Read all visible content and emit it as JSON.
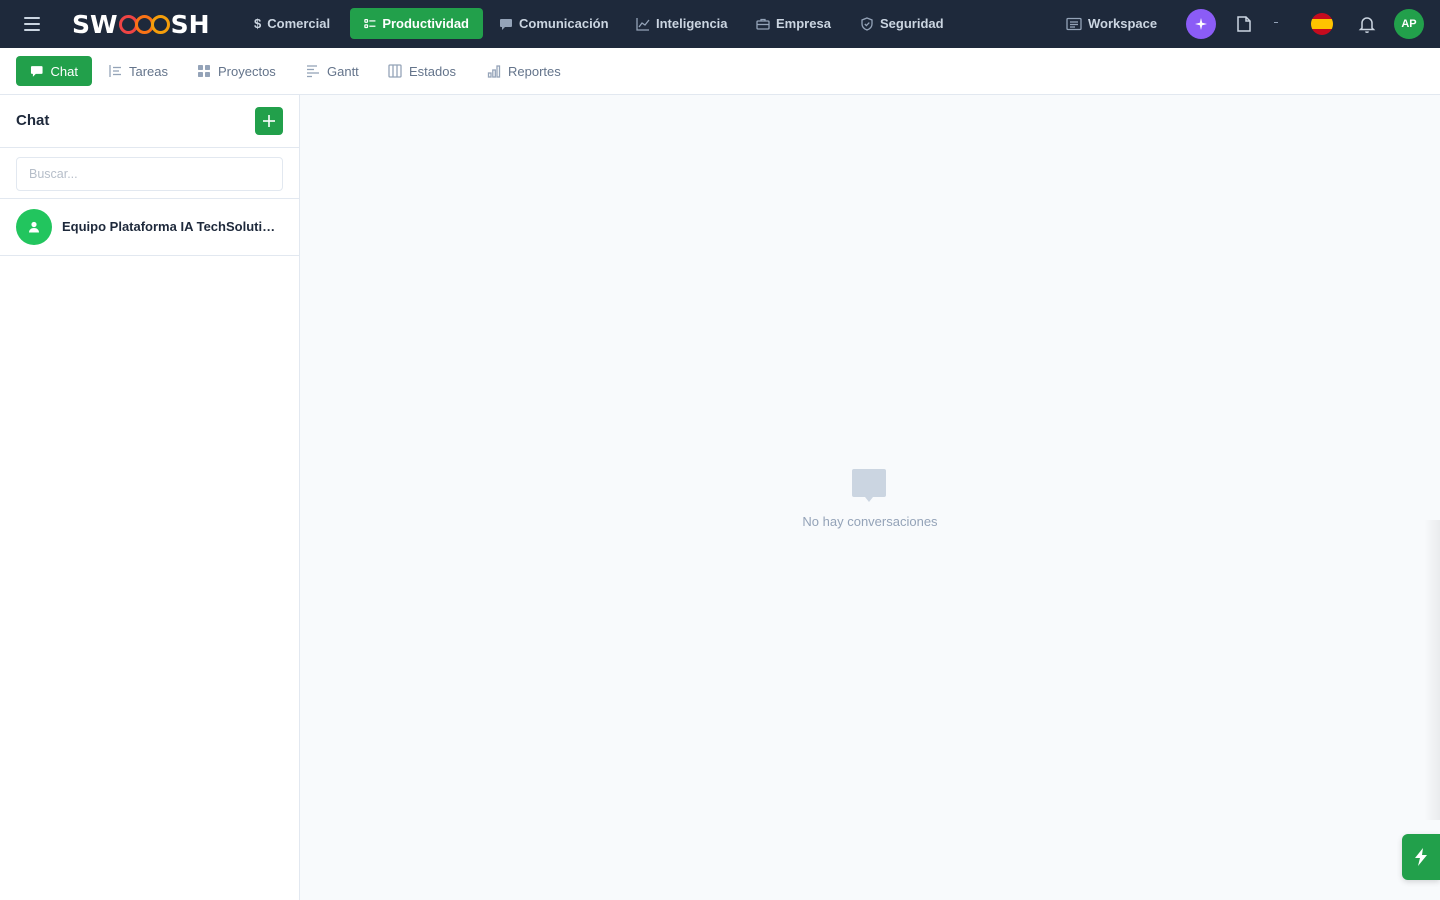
{
  "brand": {
    "logo_prefix": "SW",
    "logo_suffix": "SH"
  },
  "topnav": {
    "items": [
      {
        "label": "Comercial"
      },
      {
        "label": "Productividad"
      },
      {
        "label": "Comunicación"
      },
      {
        "label": "Inteligencia"
      },
      {
        "label": "Empresa"
      },
      {
        "label": "Seguridad"
      }
    ],
    "workspace_label": "Workspace",
    "active": "Productividad",
    "user_initials": "AP"
  },
  "subnav": {
    "items": [
      {
        "label": "Chat"
      },
      {
        "label": "Tareas"
      },
      {
        "label": "Proyectos"
      },
      {
        "label": "Gantt"
      },
      {
        "label": "Estados"
      },
      {
        "label": "Reportes"
      }
    ],
    "active": "Chat"
  },
  "sidebar": {
    "title": "Chat",
    "add_label": "+",
    "search_placeholder": "Buscar...",
    "conversations": [
      {
        "name": "Equipo Plataforma IA TechSolutions"
      }
    ]
  },
  "main": {
    "empty_text": "No hay conversaciones"
  },
  "colors": {
    "topbar": "#1e293b",
    "accent": "#22a04b",
    "ai": "#8b5cf6"
  }
}
